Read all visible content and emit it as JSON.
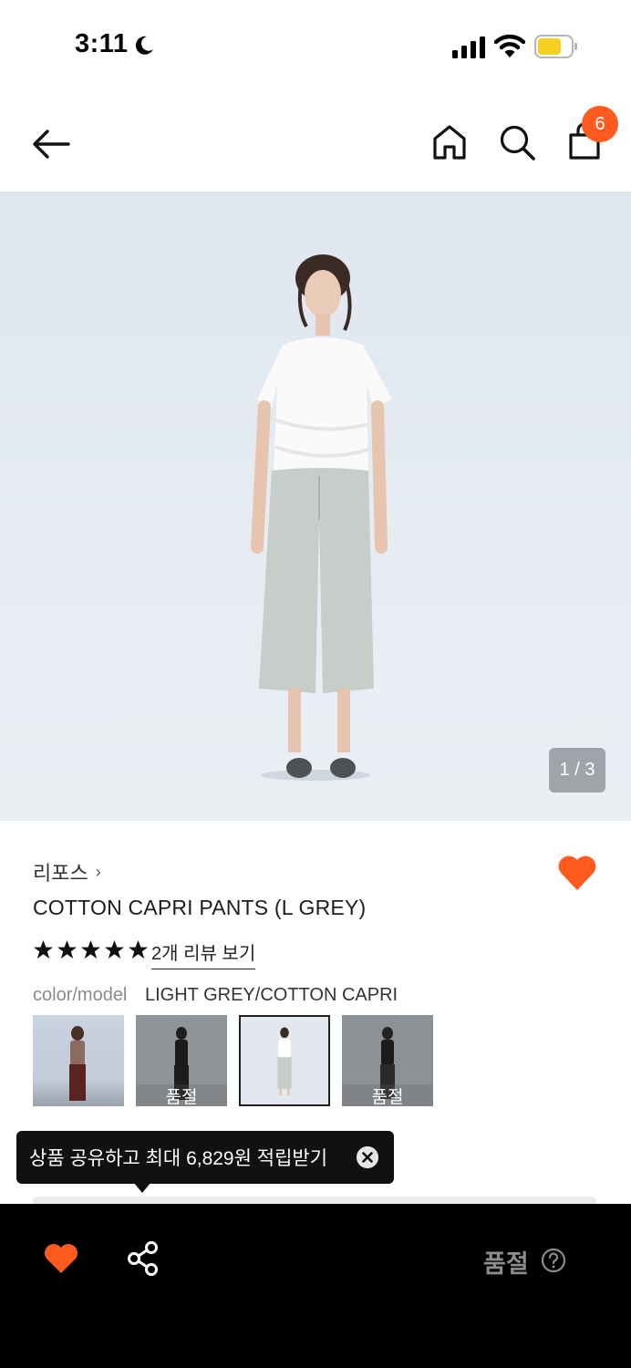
{
  "status_bar": {
    "time": "3:11"
  },
  "nav": {
    "cart_count": "6"
  },
  "hero": {
    "pager": "1 / 3"
  },
  "product": {
    "brand": "리포스",
    "brand_chevron": "›",
    "title": "COTTON CAPRI PANTS (L GREY)",
    "rating": 5,
    "reviews_link": "2개 리뷰 보기",
    "color_label": "color/model",
    "color_value": "LIGHT GREY/COTTON CAPRI"
  },
  "variants": [
    {
      "sold_out_label": ""
    },
    {
      "sold_out_label": "품절"
    },
    {
      "sold_out_label": ""
    },
    {
      "sold_out_label": "품절"
    }
  ],
  "tooltip": {
    "text": "상품 공유하고 최대 6,829원 적립받기"
  },
  "bottom_bar": {
    "status": "품절"
  },
  "colors": {
    "accent": "#ff5a1f",
    "bar": "#000000",
    "tooltip": "#111111"
  },
  "icons": [
    "moon-icon",
    "signal-icon",
    "wifi-icon",
    "battery-icon",
    "back-arrow-icon",
    "home-icon",
    "search-icon",
    "shopping-bag-icon",
    "heart-icon",
    "star-icon",
    "close-icon",
    "share-icon",
    "help-icon"
  ]
}
